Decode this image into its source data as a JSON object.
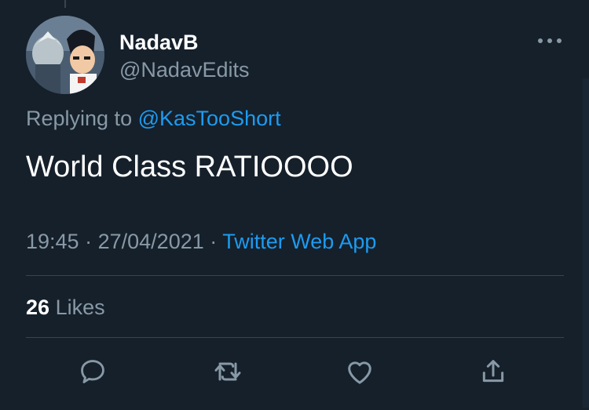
{
  "tweet": {
    "display_name": "NadavB",
    "handle": "@NadavEdits",
    "replying_prefix": "Replying to",
    "replying_to": "@KasTooShort",
    "text": "World Class RATIOOOO",
    "time": "19:45",
    "date": "27/04/2021",
    "separator": "·",
    "source": "Twitter Web App",
    "likes_count": "26",
    "likes_label": "Likes"
  },
  "icons": {
    "more": "more-horizontal-icon",
    "reply": "reply-icon",
    "retweet": "retweet-icon",
    "like": "like-icon",
    "share": "share-icon"
  },
  "colors": {
    "background": "#15202b",
    "primary_text": "#ffffff",
    "secondary_text": "#8899a6",
    "accent": "#1d9bf0",
    "divider": "#38444d"
  }
}
